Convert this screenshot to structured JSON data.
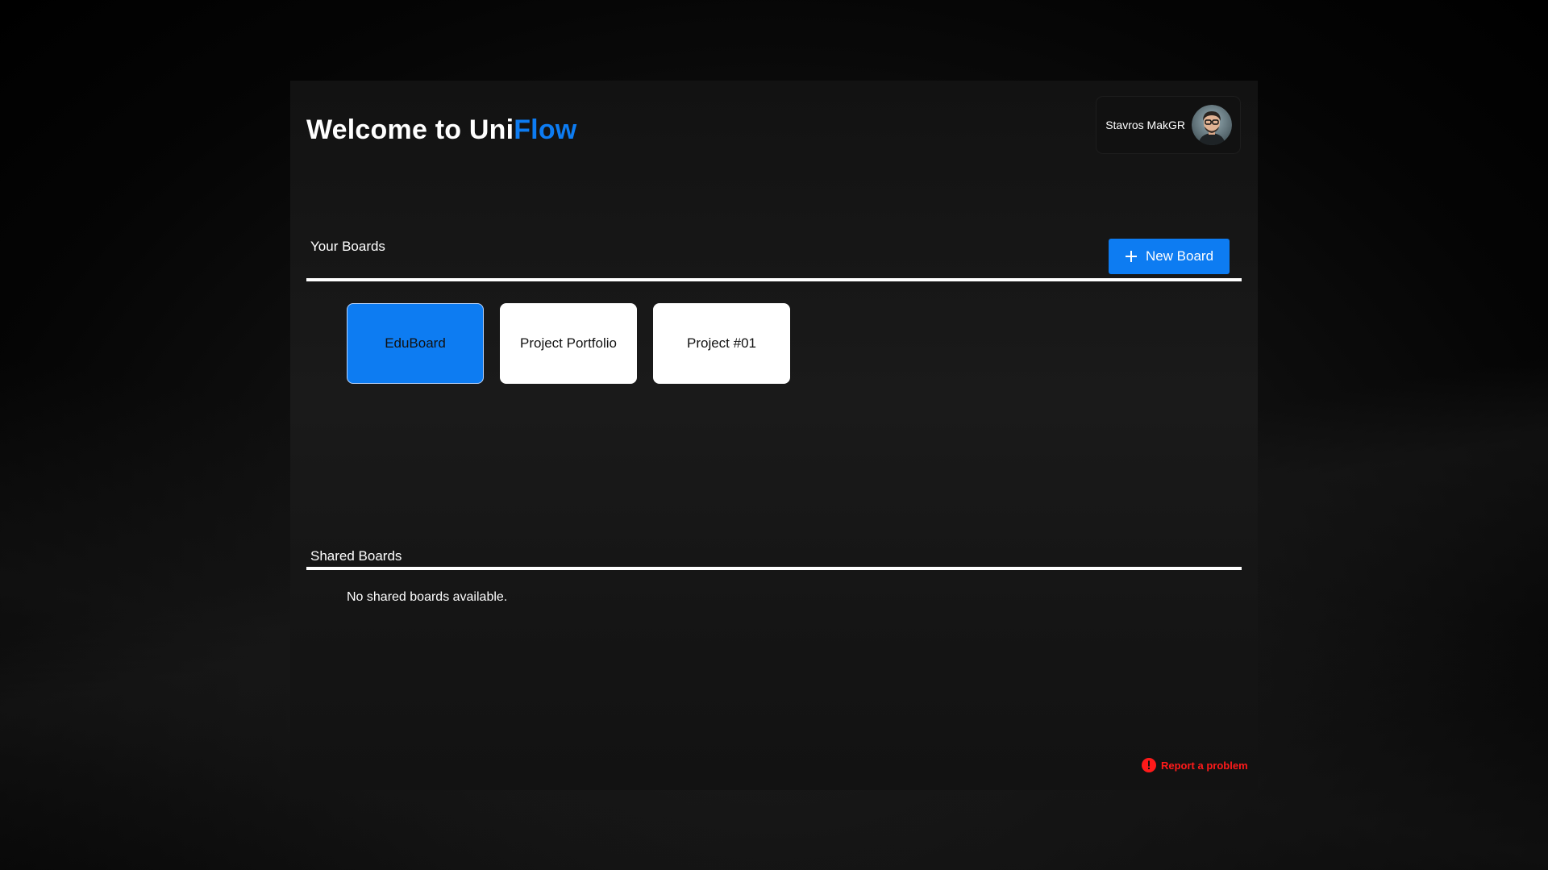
{
  "header": {
    "title_prefix": "Welcome to ",
    "brand_part1": "Uni",
    "brand_part2": "Flow"
  },
  "user": {
    "name": "Stavros MakGR",
    "avatar_icon": "user-avatar-icon"
  },
  "your_boards": {
    "label": "Your Boards",
    "new_button_label": "New Board",
    "new_button_icon": "plus-icon",
    "boards": [
      {
        "name": "EduBoard",
        "selected": true
      },
      {
        "name": "Project Portfolio",
        "selected": false
      },
      {
        "name": "Project #01",
        "selected": false
      }
    ]
  },
  "shared_boards": {
    "label": "Shared Boards",
    "empty_message": "No shared boards available."
  },
  "footer": {
    "report_label": "Report a problem",
    "report_icon": "alert-icon"
  },
  "colors": {
    "accent": "#0d7cf2",
    "danger": "#ff1a1a",
    "panel_bg": "#161616",
    "card_bg": "#ffffff"
  }
}
